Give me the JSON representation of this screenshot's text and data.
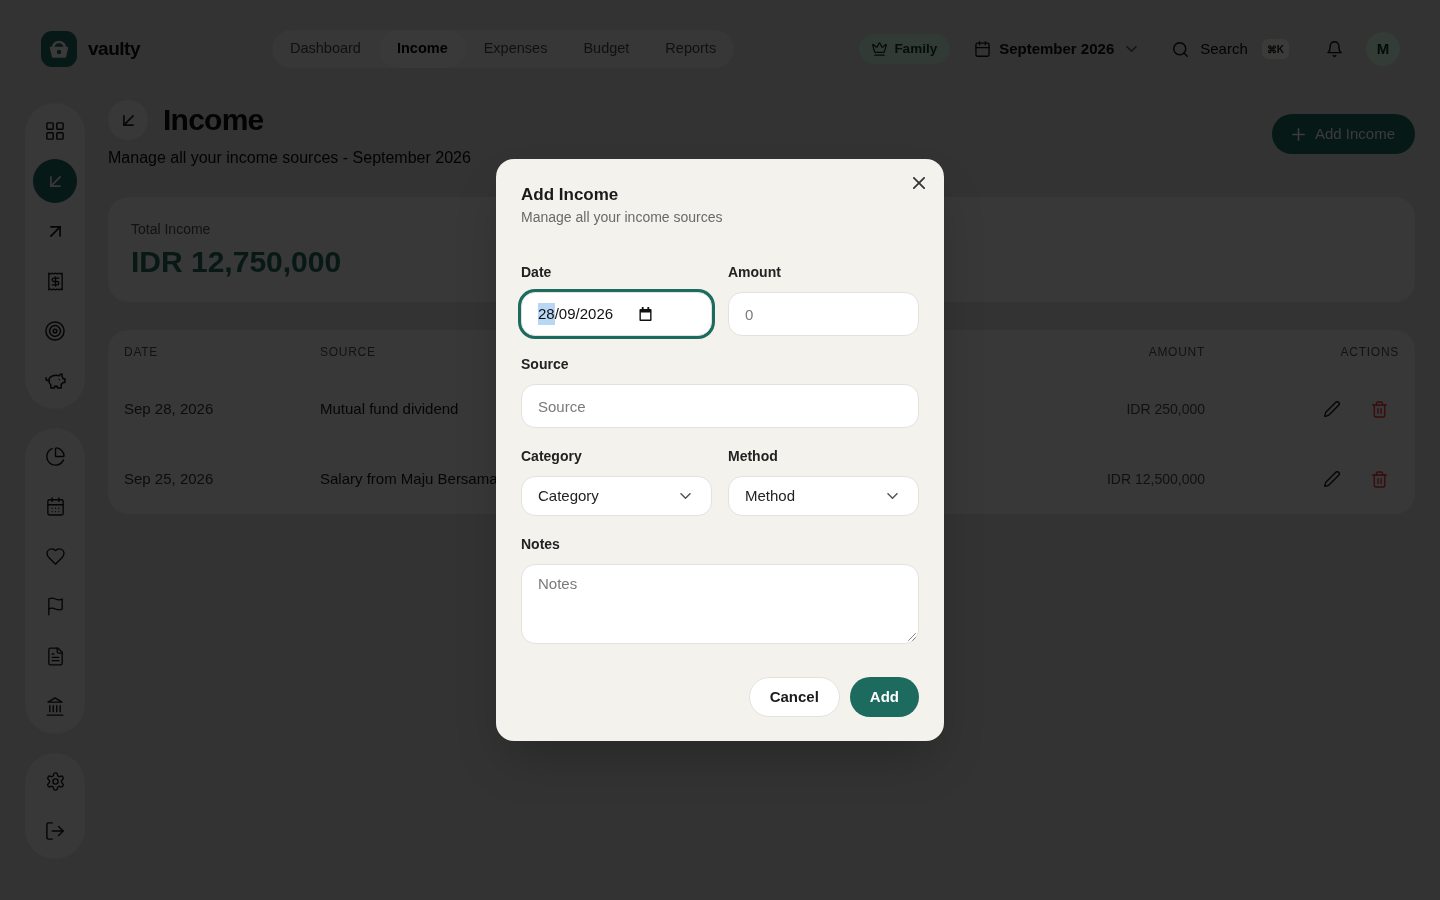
{
  "brand": {
    "name": "vaulty"
  },
  "nav": [
    {
      "label": "Dashboard",
      "selected": false
    },
    {
      "label": "Income",
      "selected": true
    },
    {
      "label": "Expenses",
      "selected": false
    },
    {
      "label": "Budget",
      "selected": false
    },
    {
      "label": "Reports",
      "selected": false
    }
  ],
  "toolbar": {
    "plan": "Family",
    "period": "September 2026",
    "search": {
      "label": "Search",
      "shortcut": "⌘K"
    },
    "avatar": "M"
  },
  "sidebar": {
    "groups": [
      {
        "items": [
          {
            "selected": false
          },
          {
            "selected": true
          },
          {
            "selected": false
          },
          {
            "selected": false
          },
          {
            "selected": false
          },
          {
            "selected": false
          }
        ]
      },
      {
        "items": [
          {
            "selected": false
          },
          {
            "selected": false
          },
          {
            "selected": false
          },
          {
            "selected": false
          },
          {
            "selected": false
          },
          {
            "selected": false
          }
        ]
      },
      {
        "items": [
          {
            "selected": false
          },
          {
            "selected": false
          }
        ]
      }
    ]
  },
  "page": {
    "title": "Income",
    "subtitle": "Manage all your income sources - September 2026",
    "primary_action": "Add Income"
  },
  "summary": {
    "label": "Total Income",
    "value": "IDR 12,750,000"
  },
  "table": {
    "columns": [
      "DATE",
      "SOURCE",
      "AMOUNT",
      "ACTIONS"
    ],
    "rows": [
      {
        "date": "Sep 28, 2026",
        "source": "Mutual fund dividend",
        "amount": "IDR 250,000"
      },
      {
        "date": "Sep 25, 2026",
        "source": "Salary from Maju Bersama",
        "amount": "IDR 12,500,000"
      }
    ]
  },
  "dialog": {
    "title": "Add Income",
    "subtitle": "Manage all your income sources",
    "field_rows": [
      [
        {
          "kind": "date",
          "label": "Date",
          "value_parts": [
            {
              "text": "28",
              "selected": true
            },
            {
              "text": "/09/2026",
              "selected": false
            }
          ],
          "focused": true
        },
        {
          "kind": "text",
          "label": "Amount",
          "placeholder": "0",
          "focused": false
        }
      ],
      [
        {
          "kind": "text",
          "label": "Source",
          "placeholder": "Source",
          "focused": false
        }
      ],
      [
        {
          "kind": "select",
          "label": "Category",
          "value": "Category",
          "focused": false
        },
        {
          "kind": "select",
          "label": "Method",
          "value": "Method",
          "focused": false
        }
      ],
      [
        {
          "kind": "textarea",
          "label": "Notes",
          "placeholder": "Notes",
          "focused": false
        }
      ]
    ],
    "buttons": [
      {
        "kind": "secondary",
        "label": "Cancel"
      },
      {
        "kind": "primary",
        "label": "Add"
      }
    ]
  }
}
